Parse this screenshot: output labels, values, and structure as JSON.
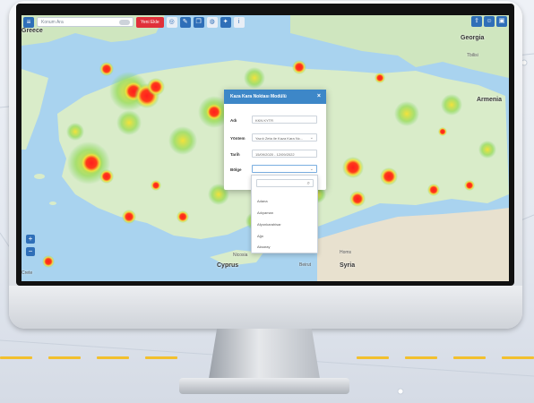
{
  "toolbar": {
    "search_placeholder": "Konum Ara",
    "red_button_label": "Yeni Ekle",
    "icons": [
      "menu-icon",
      "location-icon",
      "edit-icon",
      "layers-icon",
      "globe-icon",
      "settings-icon",
      "info-icon"
    ],
    "right_icons": [
      "share-icon",
      "user-icon",
      "lock-icon"
    ]
  },
  "map": {
    "labels": {
      "georgia": "Georgia",
      "armenia": "Armenia",
      "cyprus": "Cyprus",
      "syria": "Syria",
      "greece": "Greece",
      "crete": "Crete",
      "nicosia": "Nicosia",
      "beirut": "Beirut",
      "tbilisi": "Tbilisi",
      "homs": "Homs"
    },
    "zoom_in": "+",
    "zoom_out": "−",
    "heat_colors": {
      "low": "#7fd46a",
      "mid": "#f4e23b",
      "high": "#ff1e1e"
    }
  },
  "modal": {
    "title": "Kaza Kara Noktası Modülü",
    "close": "×",
    "fields": [
      {
        "label": "Adı",
        "value": "KKN KYTR"
      },
      {
        "label": "Yöntem",
        "value": "Yazılı Zeta ile Kaza Kara Nc..."
      },
      {
        "label": "Tarih",
        "value": "15/09/2020 - 12/09/2022"
      },
      {
        "label": "Bölge",
        "value": ""
      }
    ]
  },
  "dropdown": {
    "options": [
      "Adana",
      "Adıyaman",
      "Afyonkarahisar",
      "Ağrı",
      "Aksaray"
    ]
  }
}
